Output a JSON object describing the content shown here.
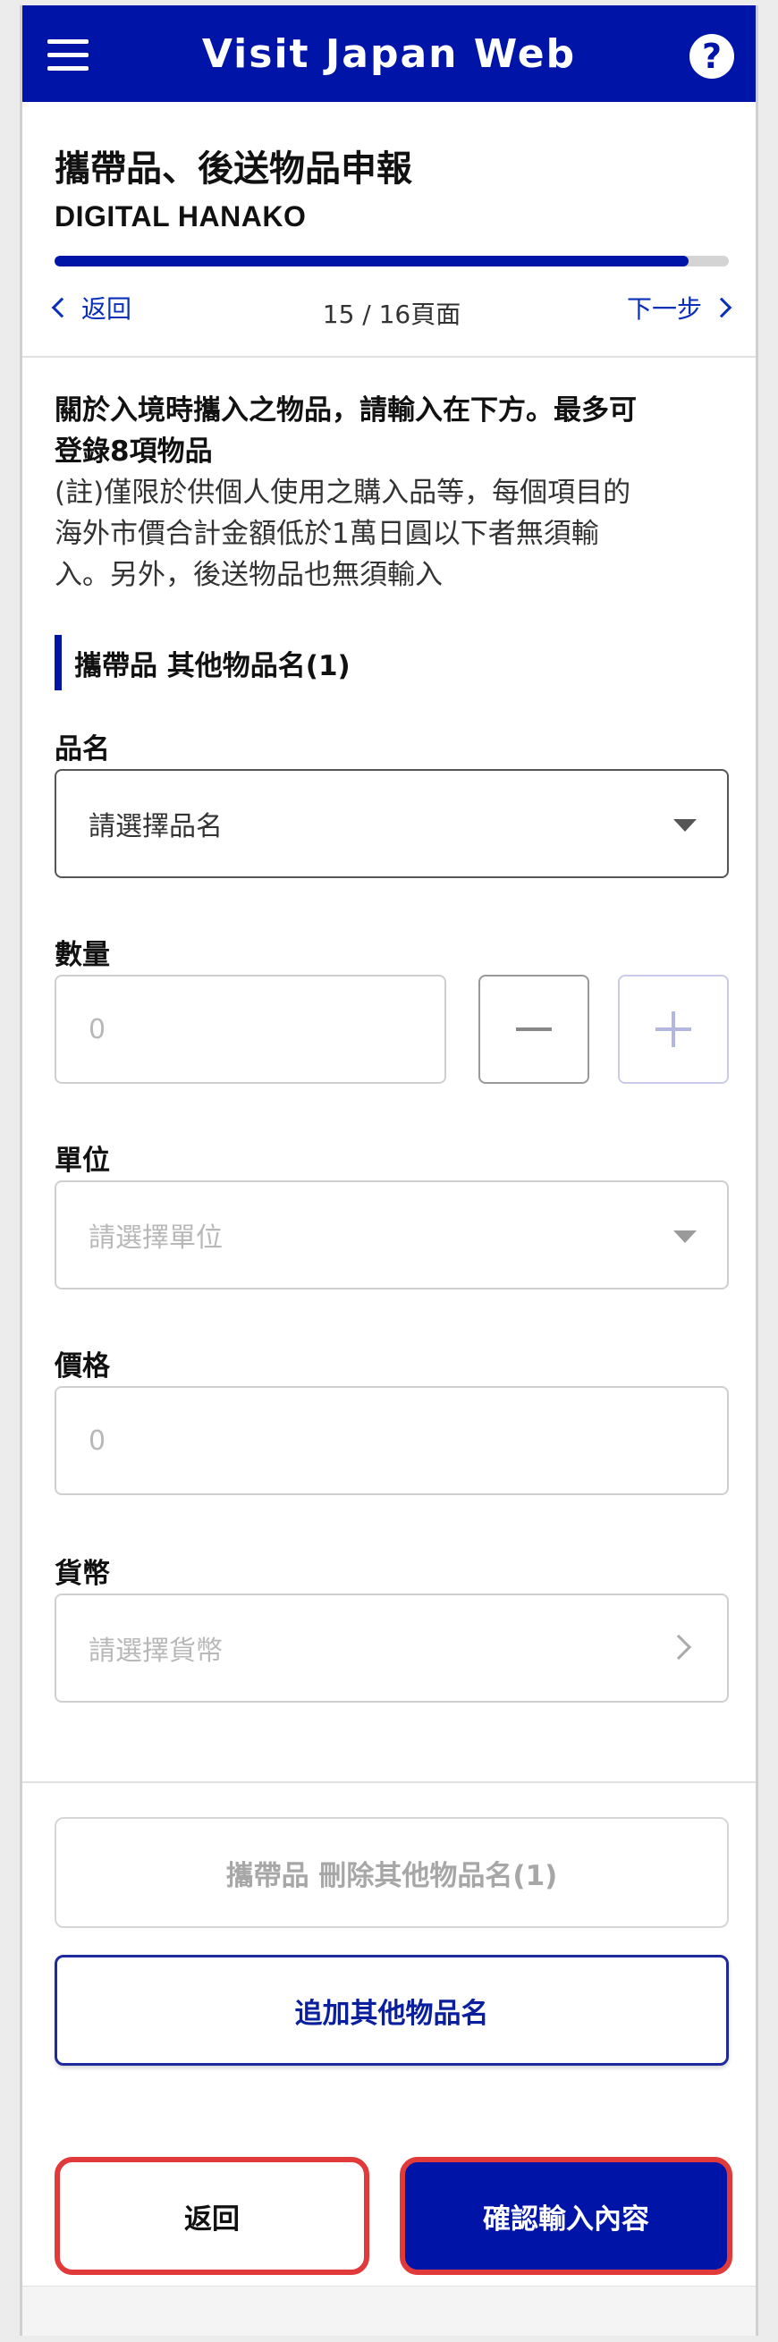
{
  "app": {
    "title": "Visit Japan Web"
  },
  "page": {
    "title": "攜帶品、後送物品申報",
    "subtitle": "DIGITAL HANAKO",
    "progress": 0.94,
    "back_label": "返回",
    "page_count": "15 / 16頁面",
    "next_label": "下一步"
  },
  "intro": {
    "bold_line1": "關於入境時攜入之物品，請輸入在下方。最多可",
    "bold_line2": "登錄8項物品",
    "note_line1": "(註)僅限於供個人使用之購入品等，每個項目的",
    "note_line2": "海外市價合計金額低於1萬日圓以下者無須輸",
    "note_line3": "入。另外，後送物品也無須輸入"
  },
  "section": {
    "heading": "攜帶品 其他物品名(1)"
  },
  "form": {
    "item_name": {
      "label": "品名",
      "value": "請選擇品名"
    },
    "quantity": {
      "label": "數量",
      "placeholder": "0"
    },
    "unit": {
      "label": "單位",
      "value": "請選擇單位"
    },
    "price": {
      "label": "價格",
      "placeholder": "0"
    },
    "currency": {
      "label": "貨幣",
      "value": "請選擇貨幣"
    }
  },
  "buttons": {
    "delete": "攜帶品 刪除其他物品名(1)",
    "add": "追加其他物品名",
    "back": "返回",
    "confirm": "確認輸入內容"
  },
  "colors": {
    "brand": "#0014a8",
    "highlight": "#e03a3a"
  }
}
